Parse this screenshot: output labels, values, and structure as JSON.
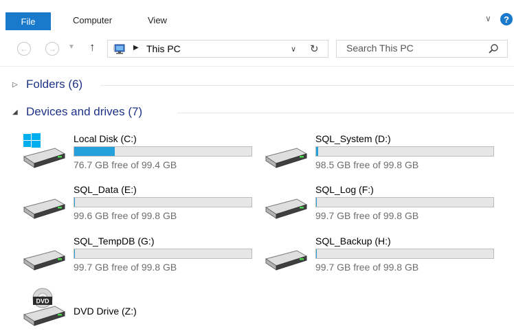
{
  "ribbon": {
    "tabs": [
      "File",
      "Computer",
      "View"
    ]
  },
  "navigation": {
    "location": "This PC",
    "search_placeholder": "Search This PC"
  },
  "groups": {
    "folders": {
      "title": "Folders (6)",
      "expanded": false
    },
    "devices": {
      "title": "Devices and drives (7)",
      "expanded": true
    }
  },
  "drives": [
    {
      "name": "Local Disk (C:)",
      "space": "76.7 GB free of 99.4 GB",
      "used_fraction": 0.228,
      "icon": "windows-drive-icon"
    },
    {
      "name": "SQL_System (D:)",
      "space": "98.5 GB free of 99.8 GB",
      "used_fraction": 0.013,
      "icon": "hard-drive-icon"
    },
    {
      "name": "SQL_Data (E:)",
      "space": "99.6 GB free of 99.8 GB",
      "used_fraction": 0.002,
      "icon": "hard-drive-icon"
    },
    {
      "name": "SQL_Log (F:)",
      "space": "99.7 GB free of 99.8 GB",
      "used_fraction": 0.001,
      "icon": "hard-drive-icon"
    },
    {
      "name": "SQL_TempDB (G:)",
      "space": "99.7 GB free of 99.8 GB",
      "used_fraction": 0.001,
      "icon": "hard-drive-icon"
    },
    {
      "name": "SQL_Backup (H:)",
      "space": "99.7 GB free of 99.8 GB",
      "used_fraction": 0.001,
      "icon": "hard-drive-icon"
    },
    {
      "name": "DVD Drive (Z:)",
      "space": "",
      "icon": "dvd-drive-icon"
    }
  ],
  "colors": {
    "accent": "#1979ca",
    "group_title": "#1e3287",
    "usage_bar": "#26a0da"
  }
}
